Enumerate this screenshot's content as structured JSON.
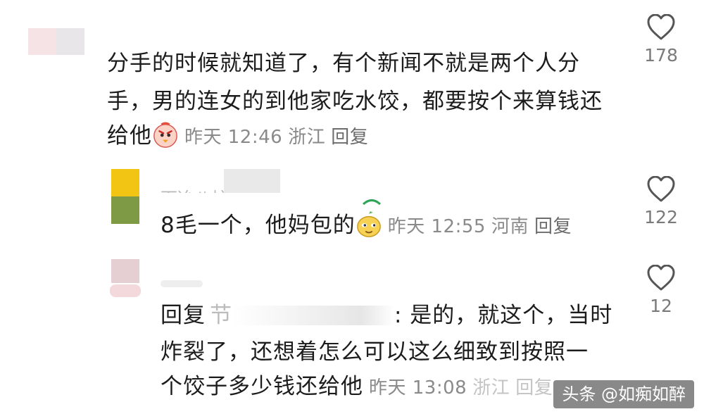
{
  "comments": [
    {
      "text_lines": [
        "分手的时候就知道了，有个新闻不就是两个人分",
        "手，男的连女的到他家吃水饺，都要按个来算钱还",
        "给他"
      ],
      "time": "昨天 12:46",
      "location": "浙江",
      "reply_label": "回复",
      "likes": "178"
    },
    {
      "username_partial": "下冶八炉",
      "text_lines": [
        "8毛一个，他妈包的"
      ],
      "time": "昨天 12:55",
      "location": "河南",
      "reply_label": "回复",
      "likes": "122"
    },
    {
      "text_prefix": "回复",
      "text_prefix_partial": "节",
      "text_after_mention": ": 是的，就这个，当时",
      "text_lines_after": [
        "炸裂了，还想着怎么可以这么细致到按照一",
        "个饺子多少钱还给他"
      ],
      "time": "昨天 13:08",
      "location_partial": "浙江",
      "reply_partial": "回复",
      "likes": "12"
    }
  ],
  "watermark": "头条 @如痴如醉",
  "icons": {
    "like": "heart-outline-icon"
  },
  "colors": {
    "text": "#1c1c1c",
    "meta": "#8a8a8a",
    "heart": "#555555"
  }
}
